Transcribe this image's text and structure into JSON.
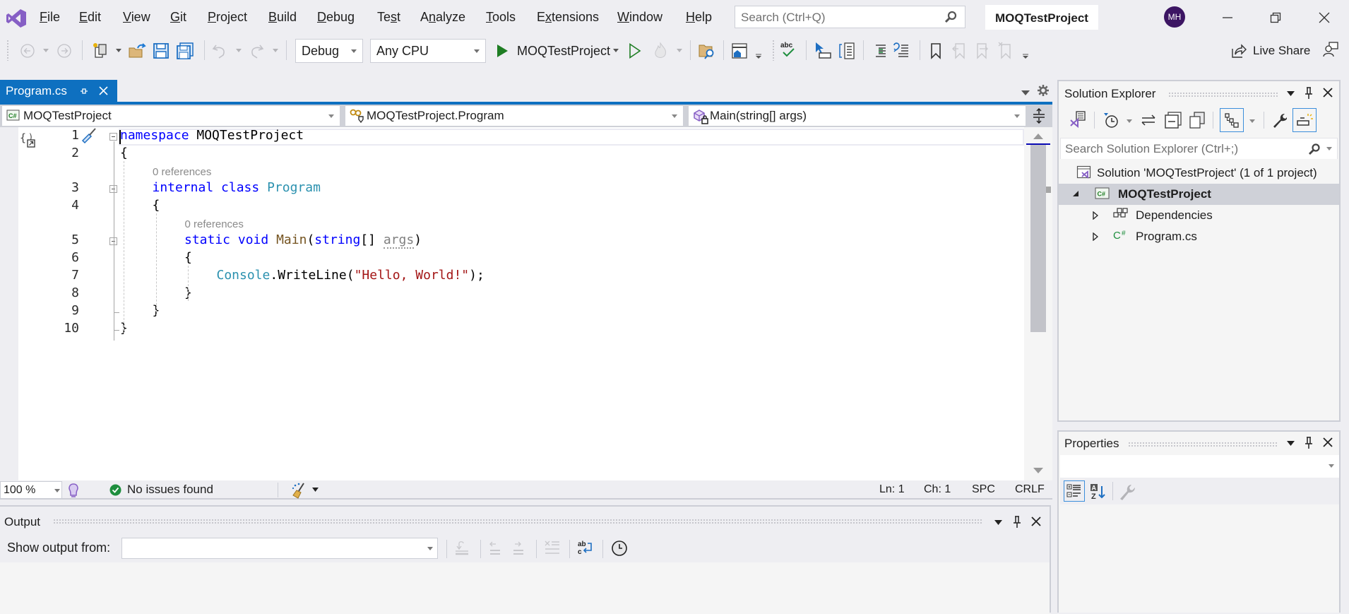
{
  "menu": {
    "items": [
      {
        "label": "File",
        "mnemonic": "F"
      },
      {
        "label": "Edit",
        "mnemonic": "E"
      },
      {
        "label": "View",
        "mnemonic": "V"
      },
      {
        "label": "Git",
        "mnemonic": "G"
      },
      {
        "label": "Project",
        "mnemonic": "P"
      },
      {
        "label": "Build",
        "mnemonic": "B"
      },
      {
        "label": "Debug",
        "mnemonic": "D"
      },
      {
        "label": "Test",
        "mnemonic": "s"
      },
      {
        "label": "Analyze",
        "mnemonic": "n"
      },
      {
        "label": "Tools",
        "mnemonic": "T"
      },
      {
        "label": "Extensions",
        "mnemonic": "x"
      },
      {
        "label": "Window",
        "mnemonic": "W"
      },
      {
        "label": "Help",
        "mnemonic": "H"
      }
    ],
    "search_placeholder": "Search (Ctrl+Q)",
    "project_name": "MOQTestProject",
    "avatar_initials": "MH"
  },
  "toolbar": {
    "configuration": "Debug",
    "platform": "Any CPU",
    "start_target": "MOQTestProject",
    "live_share": "Live Share"
  },
  "document": {
    "tab_title": "Program.cs",
    "nav": {
      "project": "MOQTestProject",
      "type": "MOQTestProject.Program",
      "member": "Main(string[] args)"
    },
    "lines": [
      {
        "n": "1",
        "tokens": [
          {
            "t": "namespace",
            "c": "kw"
          },
          {
            "t": " MOQTestProject",
            "c": ""
          }
        ]
      },
      {
        "n": "2",
        "tokens": [
          {
            "t": "{",
            "c": ""
          }
        ]
      },
      {
        "n": "3",
        "lens": "0 references",
        "tokens": [
          {
            "t": "internal",
            "c": "kw"
          },
          {
            "t": " ",
            "c": ""
          },
          {
            "t": "class",
            "c": "kw"
          },
          {
            "t": " ",
            "c": ""
          },
          {
            "t": "Program",
            "c": "ty"
          }
        ]
      },
      {
        "n": "4",
        "tokens": [
          {
            "t": "{",
            "c": ""
          }
        ]
      },
      {
        "n": "5",
        "lens": "0 references",
        "tokens": [
          {
            "t": "static",
            "c": "kw"
          },
          {
            "t": " ",
            "c": ""
          },
          {
            "t": "void",
            "c": "kw"
          },
          {
            "t": " ",
            "c": ""
          },
          {
            "t": "Main",
            "c": "mt"
          },
          {
            "t": "(",
            "c": ""
          },
          {
            "t": "string",
            "c": "kw"
          },
          {
            "t": "[] ",
            "c": ""
          },
          {
            "t": "args",
            "c": "pa"
          },
          {
            "t": ")",
            "c": ""
          }
        ]
      },
      {
        "n": "6",
        "tokens": [
          {
            "t": "{",
            "c": ""
          }
        ]
      },
      {
        "n": "7",
        "tokens": [
          {
            "t": "Console",
            "c": "ty"
          },
          {
            "t": ".WriteLine(",
            "c": ""
          },
          {
            "t": "\"Hello, World!\"",
            "c": "st"
          },
          {
            "t": ");",
            "c": ""
          }
        ]
      },
      {
        "n": "8",
        "tokens": [
          {
            "t": "}",
            "c": ""
          }
        ]
      },
      {
        "n": "9",
        "tokens": [
          {
            "t": "}",
            "c": ""
          }
        ]
      },
      {
        "n": "10",
        "tokens": [
          {
            "t": "}",
            "c": ""
          }
        ]
      }
    ]
  },
  "status": {
    "zoom": "100 %",
    "issues": "No issues found",
    "line": "Ln: 1",
    "char": "Ch: 1",
    "whitespace": "SPC",
    "line_ending": "CRLF"
  },
  "output": {
    "title": "Output",
    "show_from_label": "Show output from:",
    "show_from_value": ""
  },
  "solution_explorer": {
    "title": "Solution Explorer",
    "search_placeholder": "Search Solution Explorer (Ctrl+;)",
    "tree": [
      {
        "label": "Solution 'MOQTestProject' (1 of 1 project)",
        "level": 0,
        "icon": "solution-icon"
      },
      {
        "label": "MOQTestProject",
        "level": 1,
        "icon": "csharp-project-icon",
        "selected": true,
        "expanded": true
      },
      {
        "label": "Dependencies",
        "level": 2,
        "icon": "dependencies-icon",
        "expanded": false
      },
      {
        "label": "Program.cs",
        "level": 2,
        "icon": "csharp-file-icon",
        "expanded": false
      }
    ]
  },
  "properties": {
    "title": "Properties",
    "object_value": ""
  },
  "colors": {
    "accent": "#0e70c0",
    "vs_purple": "#865fc5",
    "keyword": "#0000ff",
    "type": "#2b91af",
    "string": "#a31515",
    "method": "#74531f",
    "avatar": "#3c1563",
    "success": "#1e8e3e",
    "selected_row": "#cfd1d8"
  }
}
